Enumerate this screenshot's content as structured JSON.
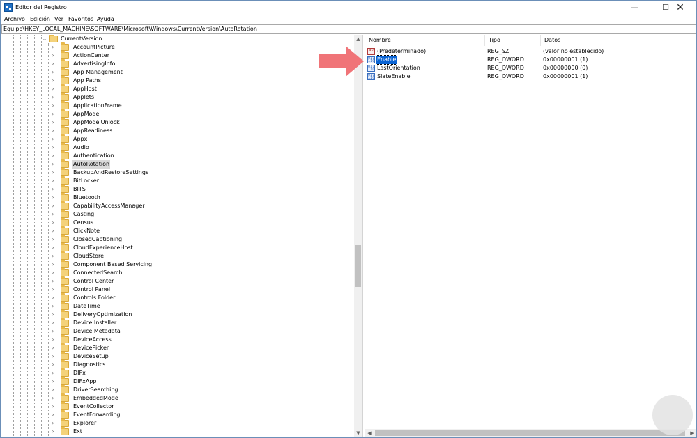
{
  "window": {
    "title": "Editor del Registro"
  },
  "controls": {
    "minimize": "—",
    "maximize": "☐",
    "close": "✕"
  },
  "menu": [
    "Archivo",
    "Edición",
    "Ver",
    "Favoritos",
    "Ayuda"
  ],
  "address": "Equipo\\HKEY_LOCAL_MACHINE\\SOFTWARE\\Microsoft\\Windows\\CurrentVersion\\AutoRotation",
  "tree": {
    "parent": "CurrentVersion",
    "selected": "AutoRotation",
    "items": [
      "AccountPicture",
      "ActionCenter",
      "AdvertisingInfo",
      "App Management",
      "App Paths",
      "AppHost",
      "Applets",
      "ApplicationFrame",
      "AppModel",
      "AppModelUnlock",
      "AppReadiness",
      "Appx",
      "Audio",
      "Authentication",
      "AutoRotation",
      "BackupAndRestoreSettings",
      "BitLocker",
      "BITS",
      "Bluetooth",
      "CapabilityAccessManager",
      "Casting",
      "Census",
      "ClickNote",
      "ClosedCaptioning",
      "CloudExperienceHost",
      "CloudStore",
      "Component Based Servicing",
      "ConnectedSearch",
      "Control Center",
      "Control Panel",
      "Controls Folder",
      "DateTime",
      "DeliveryOptimization",
      "Device Installer",
      "Device Metadata",
      "DeviceAccess",
      "DevicePicker",
      "DeviceSetup",
      "Diagnostics",
      "DIFx",
      "DIFxApp",
      "DriverSearching",
      "EmbeddedMode",
      "EventCollector",
      "EventForwarding",
      "Explorer",
      "Ext"
    ]
  },
  "columns": {
    "name": "Nombre",
    "type": "Tipo",
    "data": "Datos"
  },
  "values": [
    {
      "name": "(Predeterminado)",
      "type": "REG_SZ",
      "data": "(valor no establecido)",
      "icon": "reg-sz-icon"
    },
    {
      "name": "Enable",
      "type": "REG_DWORD",
      "data": "0x00000001 (1)",
      "icon": "reg-dword-icon",
      "selected": true
    },
    {
      "name": "LastOrientation",
      "type": "REG_DWORD",
      "data": "0x00000000 (0)",
      "icon": "reg-dword-icon"
    },
    {
      "name": "SlateEnable",
      "type": "REG_DWORD",
      "data": "0x00000001 (1)",
      "icon": "reg-dword-icon"
    }
  ],
  "icon_glyphs": {
    "sz": "ab",
    "dword": "011 110"
  },
  "colors": {
    "arrow": "#f07478",
    "selection": "#0a64d4",
    "folder": "#f4d27a"
  }
}
